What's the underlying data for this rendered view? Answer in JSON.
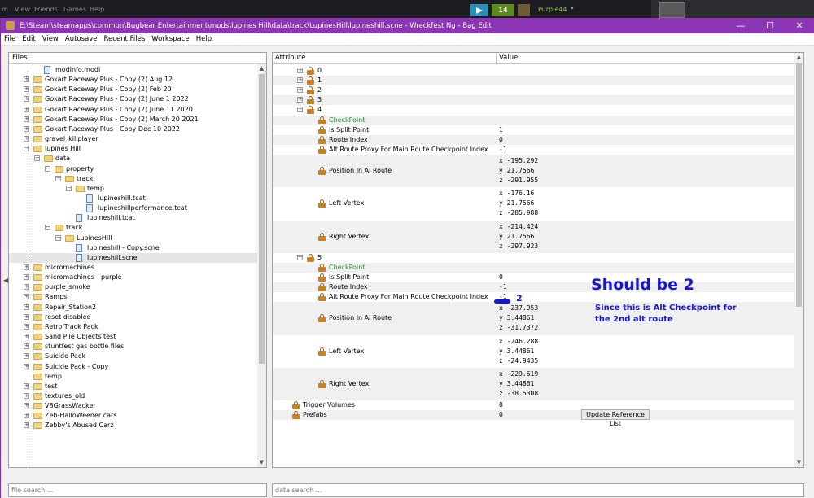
{
  "taskbar": {
    "menu": [
      "m",
      "View",
      "Friends",
      "Games",
      "Help"
    ],
    "badge_count": "14",
    "user_name": "Purple44"
  },
  "window": {
    "title": "E:\\Steam\\steamapps\\common\\Bugbear Entertainment\\mods\\lupines Hill\\data\\track\\LupinesHill\\lupineshill.scne - Wreckfest Ng - Bag Edit",
    "minimize": "—",
    "maximize": "☐",
    "close": "✕"
  },
  "menubar": [
    "File",
    "Edit",
    "View",
    "Autosave",
    "Recent Files",
    "Workspace",
    "Help"
  ],
  "files_panel": {
    "header": "Files",
    "search_placeholder": "file search ...",
    "tree": [
      {
        "label": "modinfo.modi",
        "level": 2,
        "type": "file",
        "expander": ""
      },
      {
        "label": "Gokart Raceway Plus - Copy (2) Aug 12",
        "level": 1,
        "type": "folder",
        "expander": "+"
      },
      {
        "label": "Gokart Raceway Plus - Copy (2) Feb 20",
        "level": 1,
        "type": "folder",
        "expander": "+"
      },
      {
        "label": "Gokart Raceway Plus - Copy (2) June 1 2022",
        "level": 1,
        "type": "folder",
        "expander": "+"
      },
      {
        "label": "Gokart Raceway Plus - Copy (2) June 11 2020",
        "level": 1,
        "type": "folder",
        "expander": "+"
      },
      {
        "label": "Gokart Raceway Plus - Copy (2) March 20 2021",
        "level": 1,
        "type": "folder",
        "expander": "+"
      },
      {
        "label": "Gokart Raceway Plus - Copy Dec 10 2022",
        "level": 1,
        "type": "folder",
        "expander": "+"
      },
      {
        "label": "gravel_killplayer",
        "level": 1,
        "type": "folder",
        "expander": "+"
      },
      {
        "label": "lupines Hill",
        "level": 1,
        "type": "folder",
        "expander": "-"
      },
      {
        "label": "data",
        "level": 2,
        "type": "folder",
        "expander": "-"
      },
      {
        "label": "property",
        "level": 3,
        "type": "folder",
        "expander": "-"
      },
      {
        "label": "track",
        "level": 4,
        "type": "folder",
        "expander": "-"
      },
      {
        "label": "temp",
        "level": 5,
        "type": "folder",
        "expander": "-"
      },
      {
        "label": "lupineshill.tcat",
        "level": 6,
        "type": "file",
        "expander": ""
      },
      {
        "label": "lupineshillperformance.tcat",
        "level": 6,
        "type": "file",
        "expander": ""
      },
      {
        "label": "lupineshill.tcat",
        "level": 5,
        "type": "file",
        "expander": ""
      },
      {
        "label": "track",
        "level": 3,
        "type": "folder",
        "expander": "-"
      },
      {
        "label": "LupinesHill",
        "level": 4,
        "type": "folder",
        "expander": "-"
      },
      {
        "label": "lupineshill - Copy.scne",
        "level": 5,
        "type": "file",
        "expander": ""
      },
      {
        "label": "lupineshill.scne",
        "level": 5,
        "type": "file",
        "expander": "",
        "selected": true
      },
      {
        "label": "micromachines",
        "level": 1,
        "type": "folder",
        "expander": "+"
      },
      {
        "label": "micromachines - purple",
        "level": 1,
        "type": "folder",
        "expander": "+"
      },
      {
        "label": "purple_smoke",
        "level": 1,
        "type": "folder",
        "expander": "+"
      },
      {
        "label": "Ramps",
        "level": 1,
        "type": "folder",
        "expander": "+"
      },
      {
        "label": "Repair_Station2",
        "level": 1,
        "type": "folder",
        "expander": "+"
      },
      {
        "label": "reset disabled",
        "level": 1,
        "type": "folder",
        "expander": "+"
      },
      {
        "label": "Retro Track Pack",
        "level": 1,
        "type": "folder",
        "expander": "+"
      },
      {
        "label": "Sand Pile Objects test",
        "level": 1,
        "type": "folder",
        "expander": "+"
      },
      {
        "label": "stuntfest gas bottle files",
        "level": 1,
        "type": "folder",
        "expander": "+"
      },
      {
        "label": "Suicide Pack",
        "level": 1,
        "type": "folder",
        "expander": "+"
      },
      {
        "label": "Suicide Pack - Copy",
        "level": 1,
        "type": "folder",
        "expander": "+"
      },
      {
        "label": "temp",
        "level": 1,
        "type": "folder",
        "expander": ""
      },
      {
        "label": "test",
        "level": 1,
        "type": "folder",
        "expander": "+"
      },
      {
        "label": "textures_old",
        "level": 1,
        "type": "folder",
        "expander": "+"
      },
      {
        "label": "V8GrassWacker",
        "level": 1,
        "type": "folder",
        "expander": "+"
      },
      {
        "label": "Zeb-HalloWeener cars",
        "level": 1,
        "type": "folder",
        "expander": "+"
      },
      {
        "label": "Zebby's Abused Carz",
        "level": 1,
        "type": "folder",
        "expander": "+"
      }
    ]
  },
  "attributes_panel": {
    "col_attribute": "Attribute",
    "col_value": "Value",
    "search_placeholder": "data search ...",
    "update_button": "Update Reference List",
    "rows": [
      {
        "name": "0",
        "indent": 2,
        "expander": "+",
        "lock": true,
        "values": [
          ""
        ]
      },
      {
        "name": "1",
        "indent": 2,
        "expander": "+",
        "lock": true,
        "values": [
          ""
        ]
      },
      {
        "name": "2",
        "indent": 2,
        "expander": "+",
        "lock": true,
        "values": [
          ""
        ]
      },
      {
        "name": "3",
        "indent": 2,
        "expander": "+",
        "lock": true,
        "values": [
          ""
        ]
      },
      {
        "name": "4",
        "indent": 2,
        "expander": "-",
        "lock": true,
        "values": [
          ""
        ]
      },
      {
        "name": "CheckPoint",
        "indent": 3,
        "expander": "",
        "lock": true,
        "green": true,
        "values": [
          ""
        ]
      },
      {
        "name": "Is Split Point",
        "indent": 3,
        "expander": "",
        "lock": true,
        "values": [
          "1"
        ]
      },
      {
        "name": "Route Index",
        "indent": 3,
        "expander": "",
        "lock": true,
        "values": [
          "0"
        ]
      },
      {
        "name": "Alt Route Proxy For Main Route Checkpoint Index",
        "indent": 3,
        "expander": "",
        "lock": true,
        "values": [
          "-1"
        ]
      },
      {
        "name": "Position In Ai Route",
        "indent": 3,
        "expander": "",
        "lock": true,
        "values": [
          "x -195.292",
          "y 21.7566",
          "z -291.955"
        ]
      },
      {
        "name": "Left Vertex",
        "indent": 3,
        "expander": "",
        "lock": true,
        "values": [
          "x -176.16",
          "y 21.7566",
          "z -285.988"
        ]
      },
      {
        "name": "Right Vertex",
        "indent": 3,
        "expander": "",
        "lock": true,
        "values": [
          "x -214.424",
          "y 21.7566",
          "z -297.923"
        ]
      },
      {
        "name": "5",
        "indent": 2,
        "expander": "-",
        "lock": true,
        "values": [
          ""
        ]
      },
      {
        "name": "CheckPoint",
        "indent": 3,
        "expander": "",
        "lock": true,
        "green": true,
        "values": [
          ""
        ]
      },
      {
        "name": "Is Split Point",
        "indent": 3,
        "expander": "",
        "lock": true,
        "values": [
          "0"
        ]
      },
      {
        "name": "Route Index",
        "indent": 3,
        "expander": "",
        "lock": true,
        "values": [
          "-1"
        ]
      },
      {
        "name": "Alt Route Proxy For Main Route Checkpoint Index",
        "indent": 3,
        "expander": "",
        "lock": true,
        "values": [
          "-1"
        ]
      },
      {
        "name": "Position In Ai Route",
        "indent": 3,
        "expander": "",
        "lock": true,
        "values": [
          "x -237.953",
          "y 3.44861",
          "z -31.7372"
        ]
      },
      {
        "name": "Left Vertex",
        "indent": 3,
        "expander": "",
        "lock": true,
        "values": [
          "x -246.288",
          "y 3.44861",
          "z -24.9435"
        ]
      },
      {
        "name": "Right Vertex",
        "indent": 3,
        "expander": "",
        "lock": true,
        "values": [
          "x -229.619",
          "y 3.44861",
          "z -38.5308"
        ]
      },
      {
        "name": "Trigger Volumes",
        "indent": 1,
        "expander": "",
        "lock": true,
        "values": [
          "0"
        ]
      },
      {
        "name": "Prefabs",
        "indent": 1,
        "expander": "",
        "lock": true,
        "values": [
          "0"
        ]
      }
    ]
  },
  "annotations": {
    "route_index_fix": "2",
    "headline": "Should be 2",
    "note_line1": "Since this is Alt Checkpoint for",
    "note_line2": "the 2nd alt route"
  },
  "colors": {
    "titlebar": "#8c35b5",
    "annotation": "#1616d6",
    "checkpoint_green": "#2f8a2f"
  }
}
